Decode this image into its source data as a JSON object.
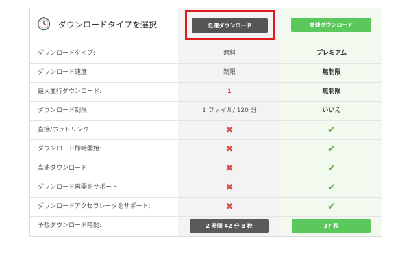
{
  "header": {
    "title": "ダウンロードタイプを選択",
    "slow_button": "低速ダウンロード",
    "fast_button": "高速ダウンロード"
  },
  "rows": [
    {
      "label": "ダウンロードタイプ:",
      "free": "無料",
      "premium": "プレミアム"
    },
    {
      "label": "ダウンロード速度:",
      "free": "制限",
      "premium": "無制限"
    },
    {
      "label": "最大並行ダウンロード:",
      "free": "1",
      "premium": "無制限"
    },
    {
      "label": "ダウンロード制限:",
      "free": "1 ファイル/ 120 分",
      "premium": "いいえ"
    },
    {
      "label": "直接/ホットリンク:",
      "free": "✖",
      "premium": "✔"
    },
    {
      "label": "ダウンロード即時開始:",
      "free": "✖",
      "premium": "✔"
    },
    {
      "label": "高速ダウンロード:",
      "free": "✖",
      "premium": "✔"
    },
    {
      "label": "ダウンロード再開をサポート:",
      "free": "✖",
      "premium": "✔"
    },
    {
      "label": "ダウンロードアクセラレータをサポート:",
      "free": "✖",
      "premium": "✔"
    }
  ],
  "footer": {
    "label": "予想ダウンロード時間:",
    "slow_time": "2 時間 42 分 8 秒",
    "fast_time": "37 秒"
  },
  "icons": {
    "clock": "clock-icon",
    "cross": "cross-icon",
    "check": "check-icon"
  },
  "colors": {
    "fast_green": "#5bc85b",
    "slow_dark": "#555555",
    "highlight_red": "#e01b1b",
    "cross_red": "#d9534f",
    "check_green": "#6ab04c"
  }
}
